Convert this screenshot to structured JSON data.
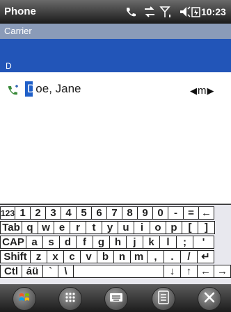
{
  "app": {
    "title": "Phone",
    "time": "10:23"
  },
  "carrier": {
    "label": "Carrier"
  },
  "group_header": {
    "letter": "D"
  },
  "contact": {
    "name_first_char": "D",
    "name_rest": "oe, Jane",
    "type": "m"
  },
  "keyboard": {
    "rows": [
      [
        "123",
        "1",
        "2",
        "3",
        "4",
        "5",
        "6",
        "7",
        "8",
        "9",
        "0",
        "-",
        "=",
        "←"
      ],
      [
        "Tab",
        "q",
        "w",
        "e",
        "r",
        "t",
        "y",
        "u",
        "i",
        "o",
        "p",
        "[",
        "]"
      ],
      [
        "CAP",
        "a",
        "s",
        "d",
        "f",
        "g",
        "h",
        "j",
        "k",
        "l",
        ";",
        "'"
      ],
      [
        "Shift",
        "z",
        "x",
        "c",
        "v",
        "b",
        "n",
        "m",
        ",",
        ".",
        "/",
        "↵"
      ],
      [
        "Ctl",
        "áü",
        "`",
        "\\",
        "",
        "↓",
        "↑",
        "←",
        "→"
      ]
    ]
  },
  "softkeys": [
    "start-icon",
    "keypad-icon",
    "keyboard-icon",
    "menu-icon",
    "close-icon"
  ]
}
